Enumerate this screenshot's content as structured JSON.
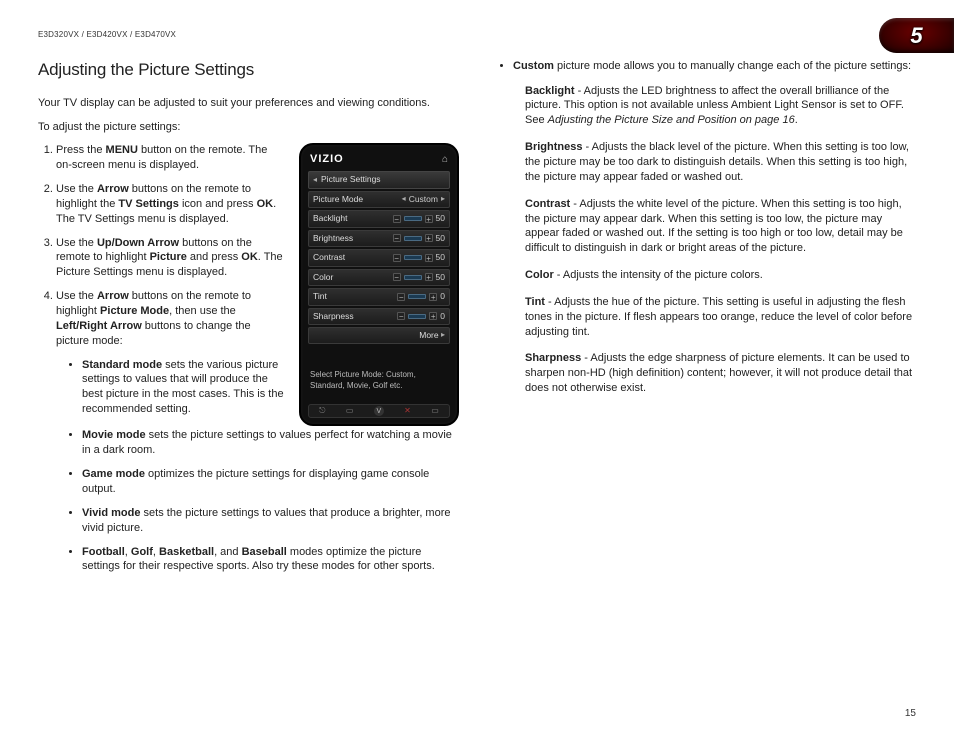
{
  "header": {
    "model_line": "E3D320VX / E3D420VX / E3D470VX",
    "chapter_number": "5"
  },
  "left": {
    "section_title": "Adjusting the Picture Settings",
    "intro": "Your TV display can be adjusted to suit your preferences and viewing conditions.",
    "lead": "To adjust the picture settings:",
    "step1_a": "Press the ",
    "step1_menu": "MENU",
    "step1_b": " button on the remote. The on-screen menu is displayed.",
    "step2_a": "Use the ",
    "step2_arrow": "Arrow",
    "step2_b": " buttons on the remote to highlight the ",
    "step2_tvs": "TV Settings",
    "step2_c": " icon and press ",
    "step2_ok": "OK",
    "step2_d": ". The TV Settings menu is displayed.",
    "step3_a": "Use the ",
    "step3_uda": "Up/Down Arrow",
    "step3_b": " buttons on the remote to highlight ",
    "step3_pic": "Picture",
    "step3_c": " and press ",
    "step3_ok": "OK",
    "step3_d": ". The Picture Settings menu is displayed.",
    "step4_a": "Use the ",
    "step4_arrow": "Arrow",
    "step4_b": " buttons on the remote to highlight ",
    "step4_pm": "Picture Mode",
    "step4_c": ", then use the ",
    "step4_lra": "Left/Right Arrow",
    "step4_d": " buttons to change the picture mode:",
    "m_standard_b": "Standard mode",
    "m_standard_t": " sets the various picture settings to values that will produce the best picture in the most cases. This is the recommended setting.",
    "m_movie_b": "Movie mode",
    "m_movie_t": " sets the picture settings to values perfect for watching a movie in a dark room.",
    "m_game_b": "Game mode",
    "m_game_t": " optimizes the picture settings for displaying game console output.",
    "m_vivid_b": "Vivid mode",
    "m_vivid_t": " sets the picture settings to values that produce a brighter, more vivid picture.",
    "m_sports_b1": "Football",
    "m_sports_s1": ", ",
    "m_sports_b2": "Golf",
    "m_sports_s2": ", ",
    "m_sports_b3": "Basketball",
    "m_sports_s3": ", and ",
    "m_sports_b4": "Baseball",
    "m_sports_t": " modes optimize the picture settings for their respective sports. Also try these modes for other sports."
  },
  "tv": {
    "brand": "VIZIO",
    "title": "Picture Settings",
    "rows": {
      "picture_mode": {
        "label": "Picture Mode",
        "value": "Custom"
      },
      "backlight": {
        "label": "Backlight",
        "value": "50"
      },
      "brightness": {
        "label": "Brightness",
        "value": "50"
      },
      "contrast": {
        "label": "Contrast",
        "value": "50"
      },
      "color": {
        "label": "Color",
        "value": "50"
      },
      "tint": {
        "label": "Tint",
        "value": "0"
      },
      "sharpness": {
        "label": "Sharpness",
        "value": "0"
      }
    },
    "more": "More",
    "help": "Select Picture Mode: Custom, Standard, Movie, Golf etc."
  },
  "right": {
    "custom_b": "Custom",
    "custom_t": " picture mode allows you to manually change each of the picture settings:",
    "backlight_b": "Backlight",
    "backlight_t_a": " - Adjusts the LED brightness to affect the overall brilliance of the picture. This option is not available unless Ambient Light Sensor is set to OFF. See ",
    "backlight_i": "Adjusting the Picture Size and Position on page 16",
    "backlight_t_b": ".",
    "brightness_b": "Brightness",
    "brightness_t": " - Adjusts the black level of the picture. When this setting is too low, the picture may be too dark to distinguish details. When this setting is too high, the picture may appear faded or washed out.",
    "contrast_b": "Contrast",
    "contrast_t": " - Adjusts the white level of the picture. When this setting is too high, the picture may appear dark. When this setting is too low, the picture may appear faded or washed out. If the setting is too high or too low, detail may be difficult to distinguish in dark or bright areas of the picture.",
    "color_b": "Color",
    "color_t": " - Adjusts the intensity of the picture colors.",
    "tint_b": "Tint",
    "tint_t": " - Adjusts the hue of the picture. This setting is useful in adjusting the flesh tones in the picture. If flesh appears too orange, reduce the level of color before adjusting tint.",
    "sharp_b": "Sharpness",
    "sharp_t": " - Adjusts the edge sharpness of picture elements. It can be used to sharpen non-HD (high definition) content; however, it will not produce detail that does not otherwise exist."
  },
  "page_number": "15"
}
